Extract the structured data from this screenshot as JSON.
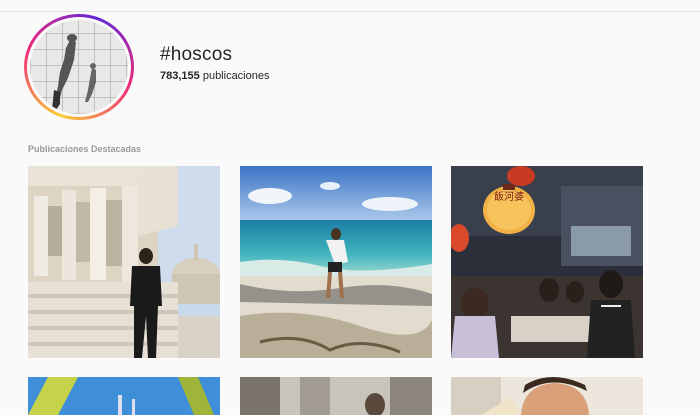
{
  "hashtag": {
    "title": "#hoscos",
    "count": "783,155",
    "count_label": "publicaciones"
  },
  "sections": {
    "featured_label": "Publicaciones Destacadas"
  },
  "posts": [
    {
      "id": "post-1",
      "subject": "temple-architecture"
    },
    {
      "id": "post-2",
      "subject": "beach"
    },
    {
      "id": "post-3",
      "subject": "night-market"
    },
    {
      "id": "post-4",
      "subject": "blue-sky-structure"
    },
    {
      "id": "post-5",
      "subject": "interior"
    },
    {
      "id": "post-6",
      "subject": "portrait"
    }
  ],
  "sign": {
    "characters": "飯河婆"
  },
  "colors": {
    "gradient_start": "#f9ce34",
    "gradient_mid": "#ee2a7b",
    "gradient_end": "#6228d7",
    "text_primary": "#262626",
    "text_secondary": "#999999"
  }
}
